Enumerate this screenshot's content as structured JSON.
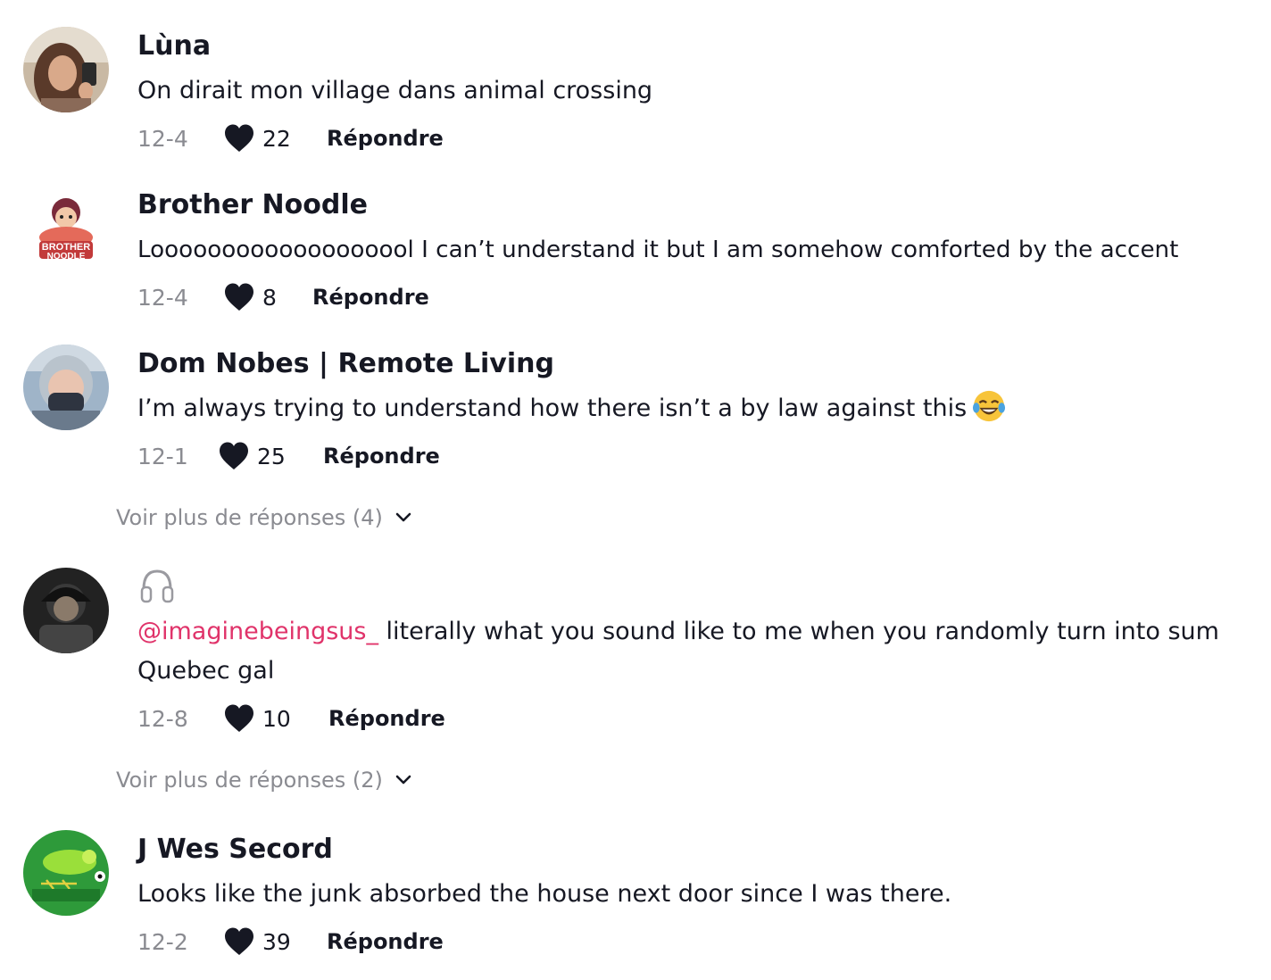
{
  "comments": [
    {
      "username": "Lùna",
      "text": "On dirait mon village dans animal crossing",
      "date": "12-4",
      "likes": "22",
      "reply_label": "Répondre",
      "avatar_icon": "profile-photo"
    },
    {
      "username": "Brother Noodle",
      "text": "Looooooooooooooooool I can’t understand it but I am somehow comforted by the accent",
      "date": "12-4",
      "likes": "8",
      "reply_label": "Répondre",
      "avatar_icon": "brother-noodle-logo",
      "avatar_logo_text": [
        "BROTHER",
        "NOODLE"
      ]
    },
    {
      "username": "Dom Nobes | Remote Living",
      "text": "I’m always trying to understand how there isn’t a by law against this",
      "text_emoji": "face-with-tears-of-joy-emoji",
      "date": "12-1",
      "likes": "25",
      "reply_label": "Répondre",
      "avatar_icon": "profile-photo",
      "more_replies": "Voir plus de réponses (4)"
    },
    {
      "username_icon": "headphones-icon",
      "mention": "@imaginebeingsus_",
      "text": " literally what you sound like to me when you randomly turn into sum Quebec gal",
      "date": "12-8",
      "likes": "10",
      "reply_label": "Répondre",
      "avatar_icon": "profile-photo",
      "more_replies": "Voir plus de réponses (2)"
    },
    {
      "username": "J Wes Secord",
      "text": "Looks like the junk absorbed the house next door since I was there.",
      "date": "12-2",
      "likes": "39",
      "reply_label": "Répondre",
      "avatar_icon": "parrot-logo"
    }
  ],
  "colors": {
    "text": "#161823",
    "muted": "#8a8b91",
    "mention": "#e0336a",
    "heart": "#161823"
  }
}
